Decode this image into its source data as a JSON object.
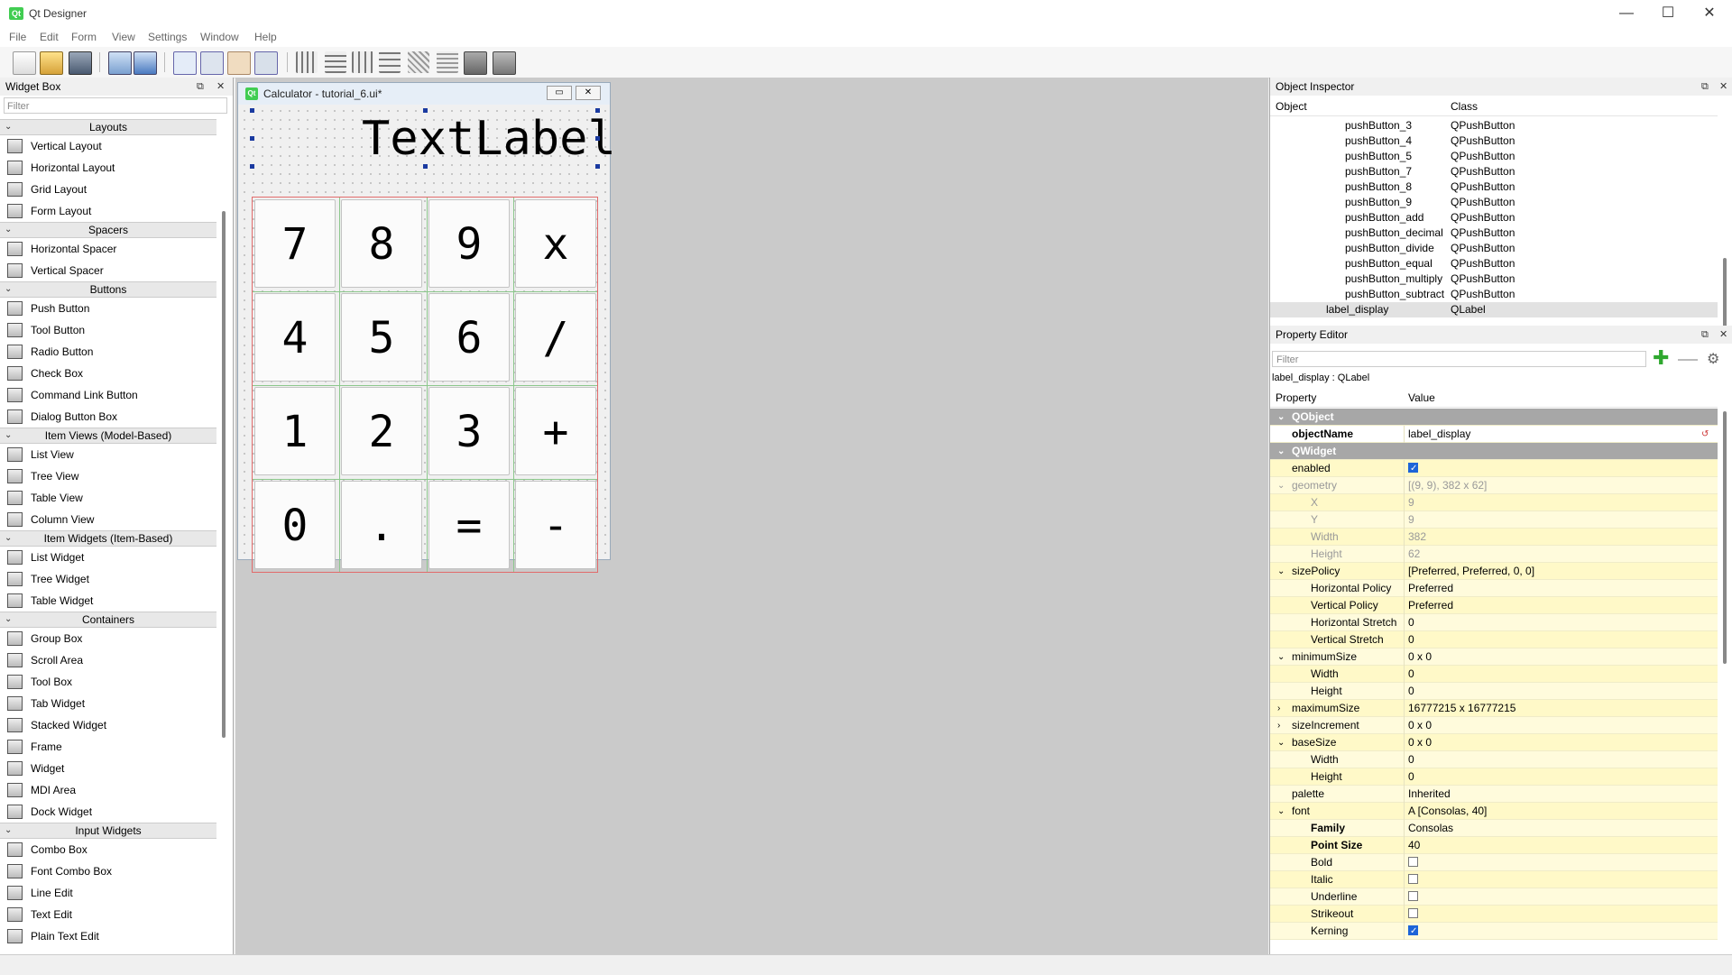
{
  "window": {
    "title": "Qt Designer",
    "app_icon": "Qt",
    "minimize": "—",
    "maximize": "☐",
    "close": "✕"
  },
  "menu": [
    "File",
    "Edit",
    "Form",
    "View",
    "Settings",
    "Window",
    "Help"
  ],
  "widget_box": {
    "title": "Widget Box",
    "filter_placeholder": "Filter",
    "categories": [
      {
        "name": "Layouts",
        "items": [
          "Vertical Layout",
          "Horizontal Layout",
          "Grid Layout",
          "Form Layout"
        ]
      },
      {
        "name": "Spacers",
        "items": [
          "Horizontal Spacer",
          "Vertical Spacer"
        ]
      },
      {
        "name": "Buttons",
        "items": [
          "Push Button",
          "Tool Button",
          "Radio Button",
          "Check Box",
          "Command Link Button",
          "Dialog Button Box"
        ]
      },
      {
        "name": "Item Views (Model-Based)",
        "items": [
          "List View",
          "Tree View",
          "Table View",
          "Column View"
        ]
      },
      {
        "name": "Item Widgets (Item-Based)",
        "items": [
          "List Widget",
          "Tree Widget",
          "Table Widget"
        ]
      },
      {
        "name": "Containers",
        "items": [
          "Group Box",
          "Scroll Area",
          "Tool Box",
          "Tab Widget",
          "Stacked Widget",
          "Frame",
          "Widget",
          "MDI Area",
          "Dock Widget"
        ]
      },
      {
        "name": "Input Widgets",
        "items": [
          "Combo Box",
          "Font Combo Box",
          "Line Edit",
          "Text Edit",
          "Plain Text Edit"
        ]
      }
    ]
  },
  "form": {
    "title": "Calculator - tutorial_6.ui*",
    "icon": "Qt",
    "label_text": "TextLabel",
    "buttons": [
      [
        "7",
        "8",
        "9",
        "x"
      ],
      [
        "4",
        "5",
        "6",
        "/"
      ],
      [
        "1",
        "2",
        "3",
        "+"
      ],
      [
        "0",
        ".",
        "=",
        "-"
      ]
    ]
  },
  "object_inspector": {
    "title": "Object Inspector",
    "col_object": "Object",
    "col_class": "Class",
    "rows": [
      {
        "object": "pushButton_3",
        "class": "QPushButton"
      },
      {
        "object": "pushButton_4",
        "class": "QPushButton"
      },
      {
        "object": "pushButton_5",
        "class": "QPushButton"
      },
      {
        "object": "pushButton_7",
        "class": "QPushButton"
      },
      {
        "object": "pushButton_8",
        "class": "QPushButton"
      },
      {
        "object": "pushButton_9",
        "class": "QPushButton"
      },
      {
        "object": "pushButton_add",
        "class": "QPushButton"
      },
      {
        "object": "pushButton_decimal",
        "class": "QPushButton"
      },
      {
        "object": "pushButton_divide",
        "class": "QPushButton"
      },
      {
        "object": "pushButton_equal",
        "class": "QPushButton"
      },
      {
        "object": "pushButton_multiply",
        "class": "QPushButton"
      },
      {
        "object": "pushButton_subtract",
        "class": "QPushButton"
      },
      {
        "object": "label_display",
        "class": "QLabel",
        "selected": true
      }
    ]
  },
  "property_editor": {
    "title": "Property Editor",
    "filter_placeholder": "Filter",
    "context": "label_display : QLabel",
    "col_property": "Property",
    "col_value": "Value",
    "rows": [
      {
        "kind": "group",
        "name": "QObject"
      },
      {
        "kind": "prop",
        "name": "objectName",
        "value": "label_display",
        "bold": true,
        "indent": 1
      },
      {
        "kind": "group",
        "name": "QWidget"
      },
      {
        "kind": "check",
        "name": "enabled",
        "checked": true,
        "indent": 1
      },
      {
        "kind": "prop",
        "name": "geometry",
        "value": "[(9, 9), 382 x 62]",
        "expand": "open",
        "indent": 1,
        "dim": true
      },
      {
        "kind": "prop",
        "name": "X",
        "value": "9",
        "indent": 2,
        "dim": true
      },
      {
        "kind": "prop",
        "name": "Y",
        "value": "9",
        "indent": 2,
        "dim": true
      },
      {
        "kind": "prop",
        "name": "Width",
        "value": "382",
        "indent": 2,
        "dim": true
      },
      {
        "kind": "prop",
        "name": "Height",
        "value": "62",
        "indent": 2,
        "dim": true
      },
      {
        "kind": "prop",
        "name": "sizePolicy",
        "value": "[Preferred, Preferred, 0, 0]",
        "expand": "open",
        "indent": 1
      },
      {
        "kind": "prop",
        "name": "Horizontal Policy",
        "value": "Preferred",
        "indent": 2
      },
      {
        "kind": "prop",
        "name": "Vertical Policy",
        "value": "Preferred",
        "indent": 2
      },
      {
        "kind": "prop",
        "name": "Horizontal Stretch",
        "value": "0",
        "indent": 2
      },
      {
        "kind": "prop",
        "name": "Vertical Stretch",
        "value": "0",
        "indent": 2
      },
      {
        "kind": "prop",
        "name": "minimumSize",
        "value": "0 x 0",
        "expand": "open",
        "indent": 1
      },
      {
        "kind": "prop",
        "name": "Width",
        "value": "0",
        "indent": 2
      },
      {
        "kind": "prop",
        "name": "Height",
        "value": "0",
        "indent": 2
      },
      {
        "kind": "prop",
        "name": "maximumSize",
        "value": "16777215 x 16777215",
        "expand": "closed",
        "indent": 1
      },
      {
        "kind": "prop",
        "name": "sizeIncrement",
        "value": "0 x 0",
        "expand": "closed",
        "indent": 1
      },
      {
        "kind": "prop",
        "name": "baseSize",
        "value": "0 x 0",
        "expand": "open",
        "indent": 1
      },
      {
        "kind": "prop",
        "name": "Width",
        "value": "0",
        "indent": 2
      },
      {
        "kind": "prop",
        "name": "Height",
        "value": "0",
        "indent": 2
      },
      {
        "kind": "prop",
        "name": "palette",
        "value": "Inherited",
        "indent": 1
      },
      {
        "kind": "prop",
        "name": "font",
        "value": "A  [Consolas, 40]",
        "expand": "open",
        "indent": 1
      },
      {
        "kind": "prop",
        "name": "Family",
        "value": "Consolas",
        "bold": true,
        "indent": 2
      },
      {
        "kind": "prop",
        "name": "Point Size",
        "value": "40",
        "bold": true,
        "indent": 2
      },
      {
        "kind": "check",
        "name": "Bold",
        "checked": false,
        "indent": 2
      },
      {
        "kind": "check",
        "name": "Italic",
        "checked": false,
        "indent": 2
      },
      {
        "kind": "check",
        "name": "Underline",
        "checked": false,
        "indent": 2
      },
      {
        "kind": "check",
        "name": "Strikeout",
        "checked": false,
        "indent": 2
      },
      {
        "kind": "check",
        "name": "Kerning",
        "checked": true,
        "indent": 2
      }
    ]
  }
}
